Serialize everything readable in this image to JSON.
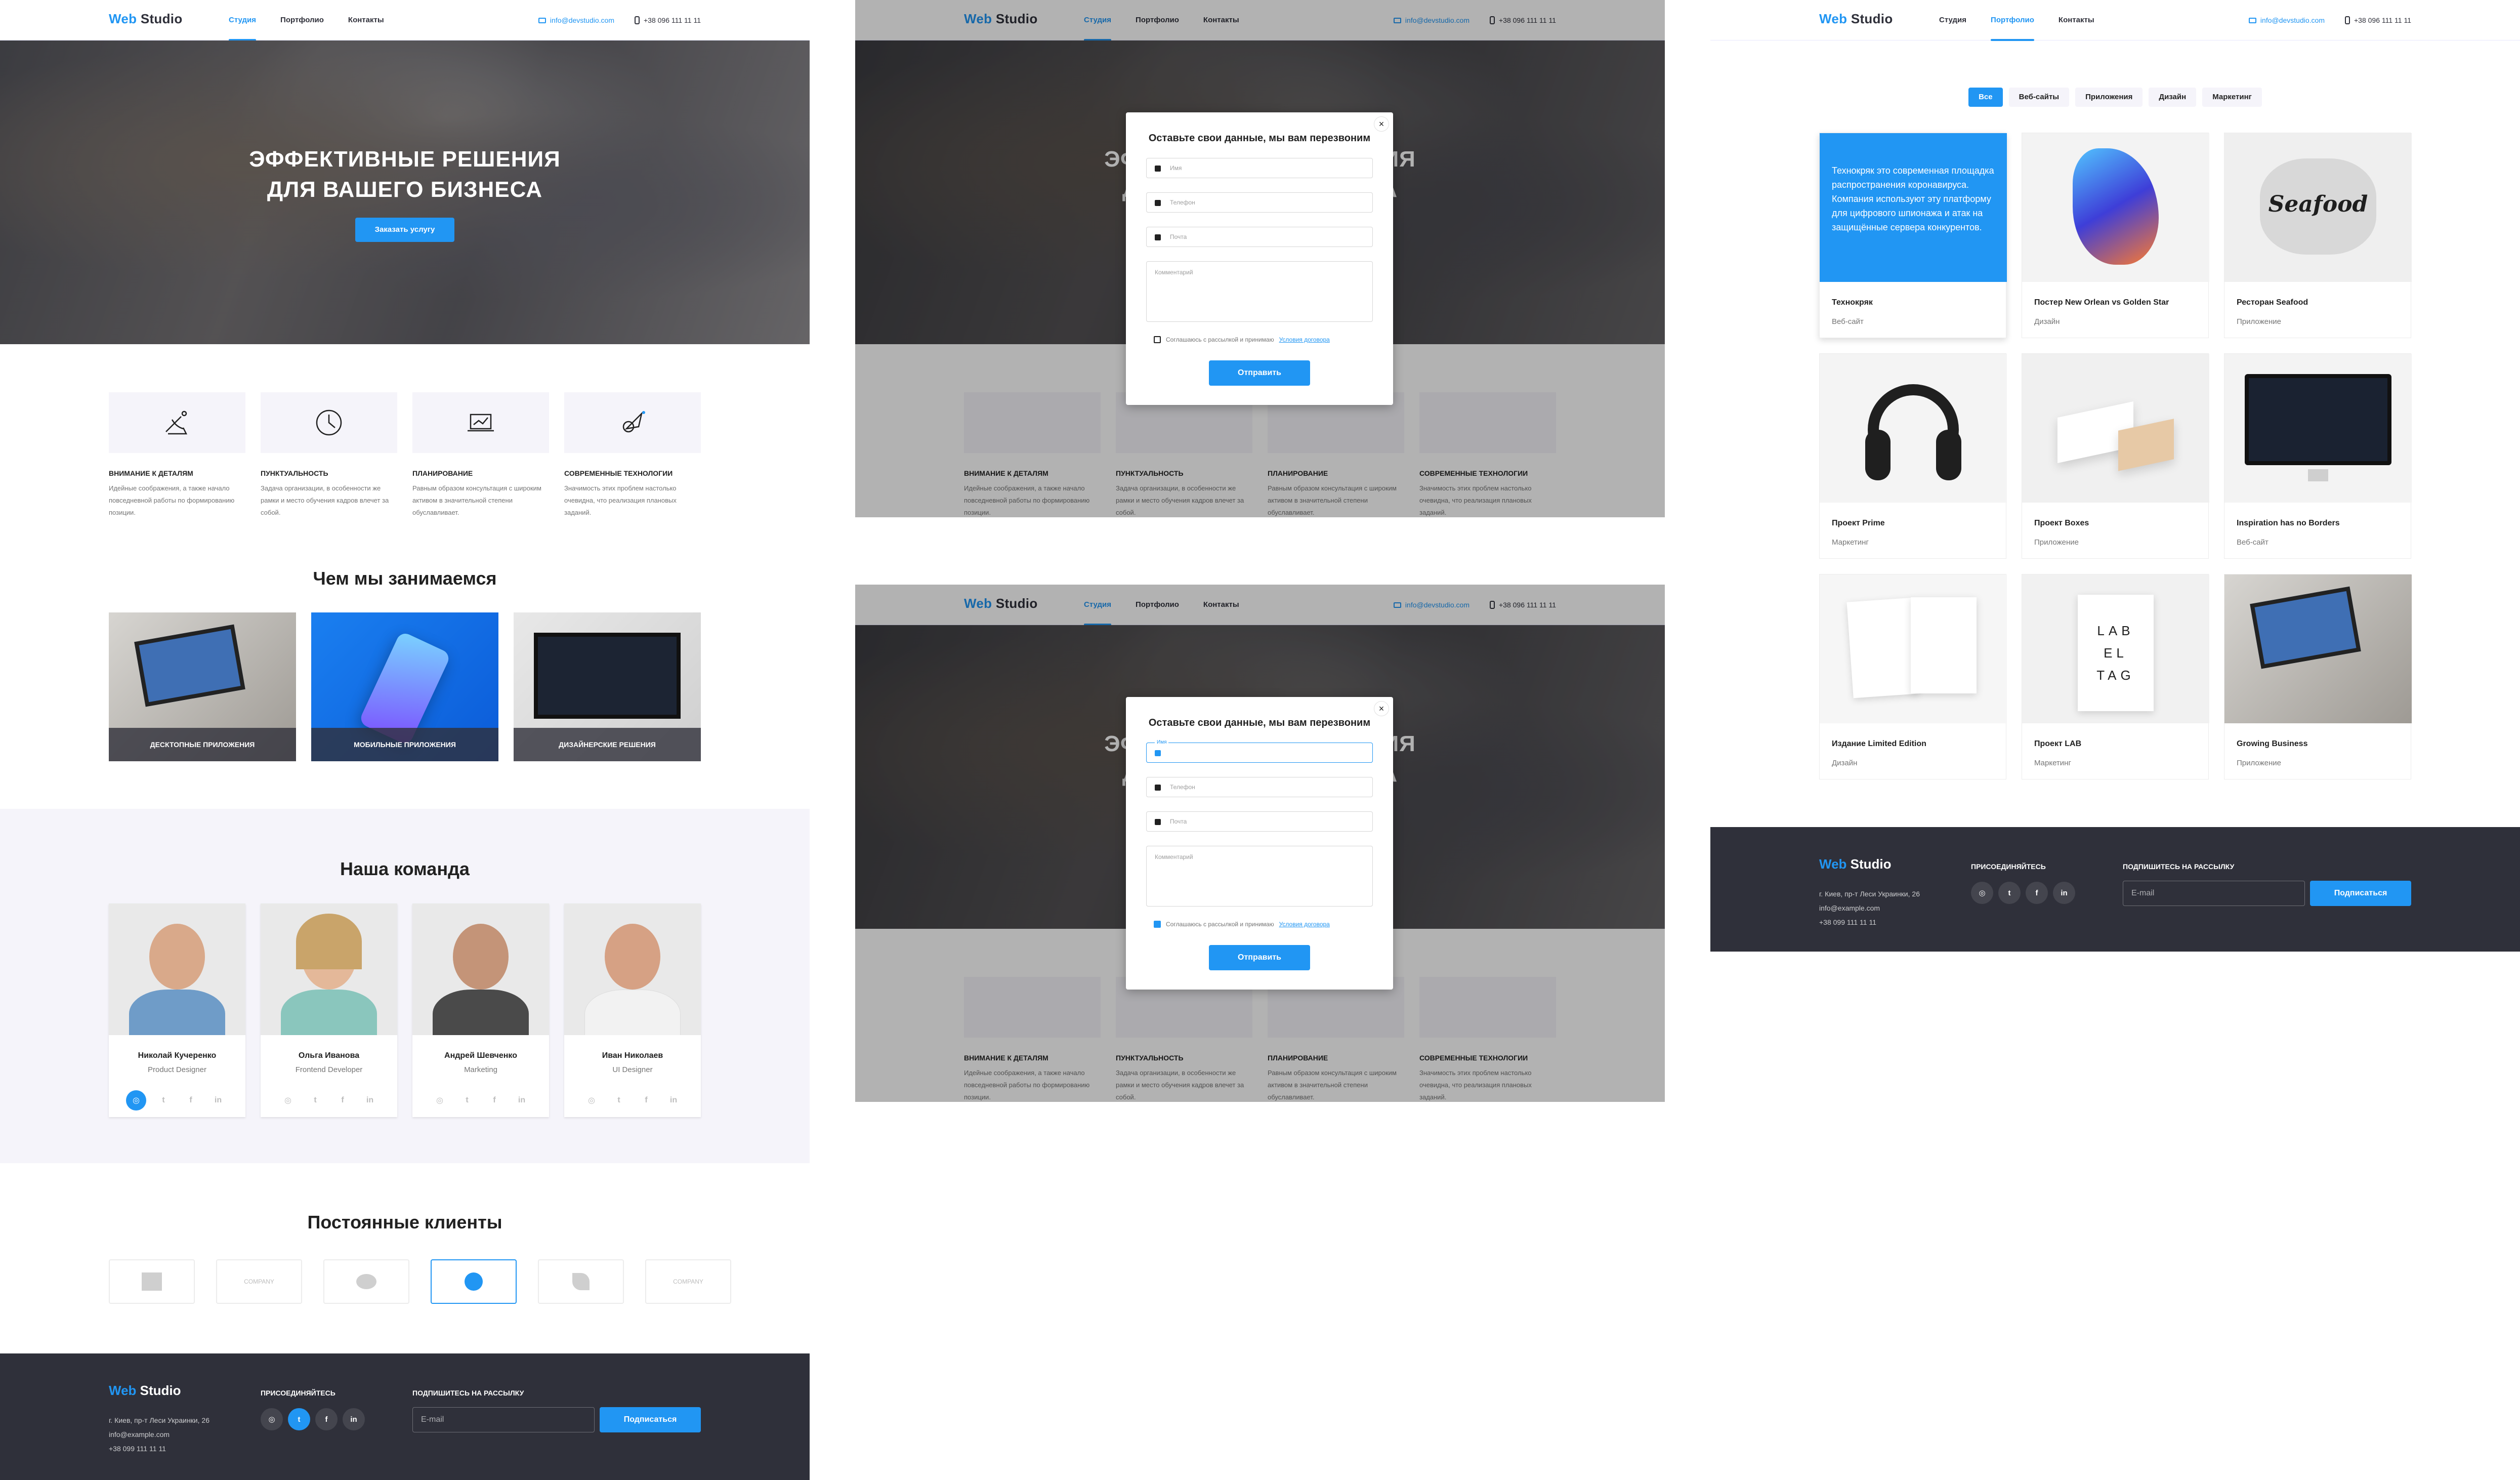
{
  "header": {
    "logo_web": "Web",
    "logo_studio": " Studio",
    "nav": [
      "Студия",
      "Портфолио",
      "Контакты"
    ],
    "email": "info@devstudio.com",
    "phone": "+38 096 111 11 11"
  },
  "hero": {
    "title_line1": "Эффективные решения",
    "title_line2": "для вашего бизнеса",
    "button": "Заказать услугу"
  },
  "features": [
    {
      "title": "Внимание к деталям",
      "text": "Идейные соображения, а также начало повседневной работы по формированию позиции.",
      "icon": "satellite-icon"
    },
    {
      "title": "Пунктуальность",
      "text": "Задача организации, в особенности же рамки и место обучения кадров влечет за собой.",
      "icon": "clock-icon"
    },
    {
      "title": "Планирование",
      "text": "Равным образом консультация с широким активом в значительной степени обуславливает.",
      "icon": "laptop-chart-icon"
    },
    {
      "title": "Современные технологии",
      "text": "Значимость этих проблем настолько очевидна, что реализация плановых заданий.",
      "icon": "rocket-icon"
    }
  ],
  "services": {
    "title": "Чем мы занимаемся",
    "items": [
      "Десктопные приложения",
      "Мобильные приложения",
      "Дизайнерские решения"
    ]
  },
  "team": {
    "title": "Наша команда",
    "members": [
      {
        "name": "Николай Кучеренко",
        "role": "Product Designer"
      },
      {
        "name": "Ольга Иванова",
        "role": "Frontend Developer"
      },
      {
        "name": "Андрей Шевченко",
        "role": "Marketing"
      },
      {
        "name": "Иван Николаев",
        "role": "UI Designer"
      }
    ]
  },
  "clients": {
    "title": "Постоянные клиенты",
    "labels": [
      "",
      "COMPANY",
      "",
      "",
      "",
      "COMPANY"
    ]
  },
  "footer": {
    "logo_web": "Web",
    "logo_studio": " Studio",
    "address": "г. Киев, пр-т Леси Украинки, 26",
    "email": "info@example.com",
    "phone": "+38 099 111 11 11",
    "social_title": "Присоединяйтесь",
    "subscribe_title": "Подпишитесь на рассылку",
    "email_placeholder": "E-mail",
    "subscribe_button": "Подписаться"
  },
  "modal": {
    "title": "Оставьте свои данные, мы вам перезвоним",
    "name_placeholder": "Имя",
    "phone_placeholder": "Телефон",
    "email_placeholder": "Почта",
    "comment_placeholder": "Комментарий",
    "consent_text": "Соглашаюсь с рассылкой и принимаю",
    "consent_link": "Условия договора",
    "submit": "Отправить",
    "close": "×",
    "focused_label": "Имя"
  },
  "portfolio": {
    "filters": [
      "Все",
      "Веб-сайты",
      "Приложения",
      "Дизайн",
      "Маркетинг"
    ],
    "overlay_text": "Технокряк это современная площадка распространения коронавирусa. Компания используют эту платформу для цифрового шпионажа и атак на защищённые сервера конкурентов.",
    "items": [
      {
        "title": "Технокряк",
        "category": "Веб-сайт"
      },
      {
        "title": "Постер New Orlean vs Golden Star",
        "category": "Дизайн"
      },
      {
        "title": "Ресторан Seafood",
        "category": "Приложение"
      },
      {
        "title": "Проект Prime",
        "category": "Маркетинг"
      },
      {
        "title": "Проект Boxes",
        "category": "Приложение"
      },
      {
        "title": "Inspiration has no Borders",
        "category": "Веб-сайт"
      },
      {
        "title": "Издание Limited Edition",
        "category": "Дизайн"
      },
      {
        "title": "Проект LAB",
        "category": "Маркетинг"
      },
      {
        "title": "Growing Business",
        "category": "Приложение"
      }
    ],
    "seafood_logo": "Seafood",
    "lab_tag": "LAB EL TAG"
  }
}
